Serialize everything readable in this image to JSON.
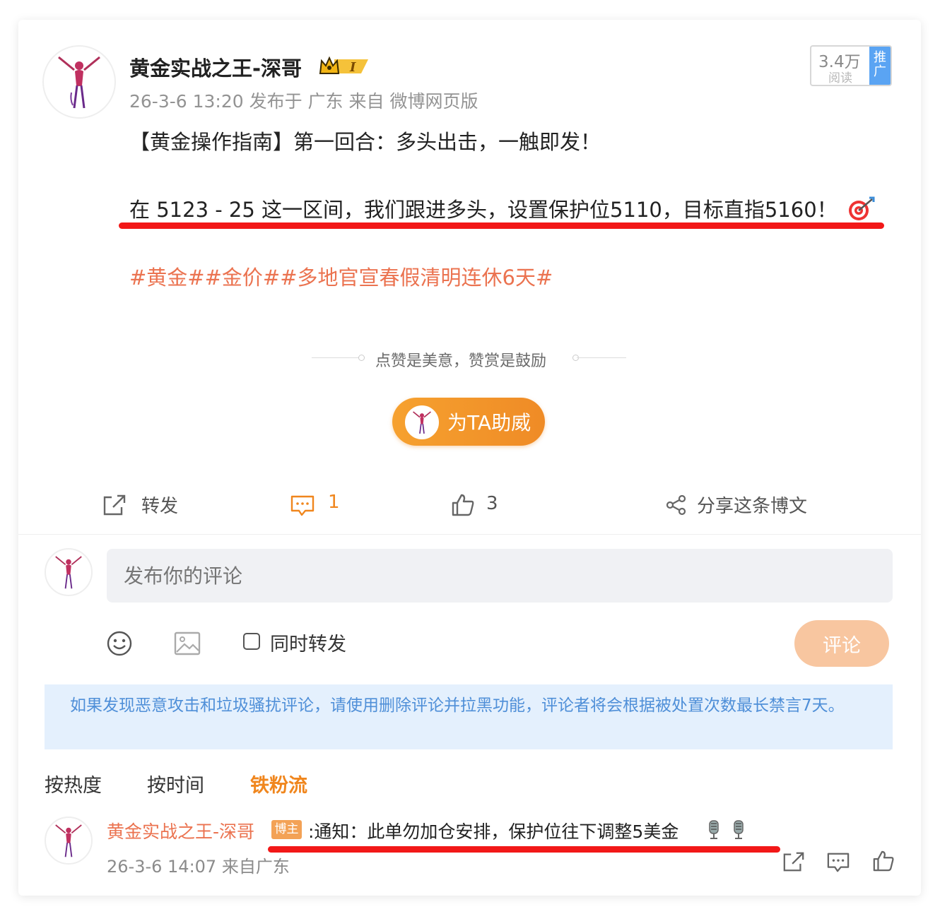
{
  "post": {
    "author": "黄金实战之王-深哥",
    "meta": "26-3-6 13:20  发布于 广东  来自 微博网页版",
    "read_count": "3.4万",
    "read_label": "阅读",
    "promo_label": "推广",
    "title_line": "【黄金操作指南】第一回合：多头出击，一触即发！",
    "body_line": "在 5123 - 25 这一区间，我们跟进多头，设置保护位5110，目标直指5160！",
    "topics": "#黄金##金价##多地官宣春假清明连休6天#"
  },
  "reward": {
    "divider_text": "点赞是美意，赞赏是鼓励",
    "button_label": "为TA助威"
  },
  "actions": {
    "repost_label": "转发",
    "comment_count": "1",
    "like_count": "3",
    "share_label": "分享这条博文"
  },
  "composer": {
    "placeholder": "发布你的评论",
    "repost_checkbox_label": "同时转发",
    "submit_label": "评论"
  },
  "notice": {
    "text": "如果发现恶意攻击和垃圾骚扰评论，请使用删除评论并拉黑功能，评论者将会根据被处置次数最长禁言7天。"
  },
  "sort_tabs": [
    {
      "label": "按热度"
    },
    {
      "label": "按时间"
    },
    {
      "label": "铁粉流"
    }
  ],
  "comment": {
    "author": "黄金实战之王-深哥",
    "badge": "博主",
    "text": ":通知：此单勿加仓安排，保护位往下调整5美金",
    "meta": "26-3-6 14:07  来自广东"
  },
  "colors": {
    "accent_orange": "#eb7350",
    "highlight_red": "#f21818",
    "notice_bg": "#e4f0fd",
    "notice_text": "#4f8fd8",
    "promo_blue": "#5aa4f3"
  }
}
